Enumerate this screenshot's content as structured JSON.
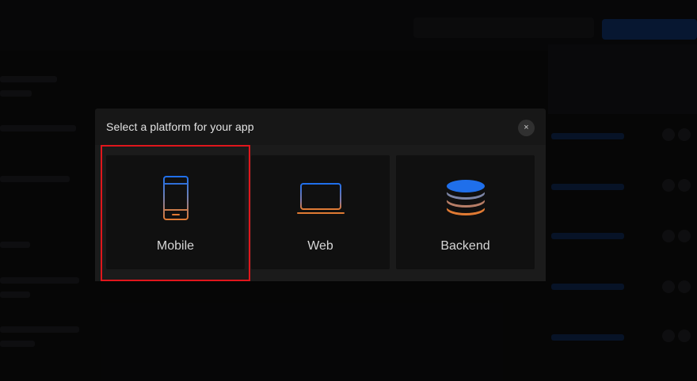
{
  "modal": {
    "title": "Select a platform for your app",
    "close_label": "×"
  },
  "platforms": [
    {
      "label": "Mobile",
      "icon": "mobile-phone-icon"
    },
    {
      "label": "Web",
      "icon": "laptop-icon"
    },
    {
      "label": "Backend",
      "icon": "database-icon"
    }
  ],
  "colors": {
    "accent_blue": "#1f6feb",
    "accent_orange": "#e07a33",
    "highlight_red": "#e0161c"
  }
}
